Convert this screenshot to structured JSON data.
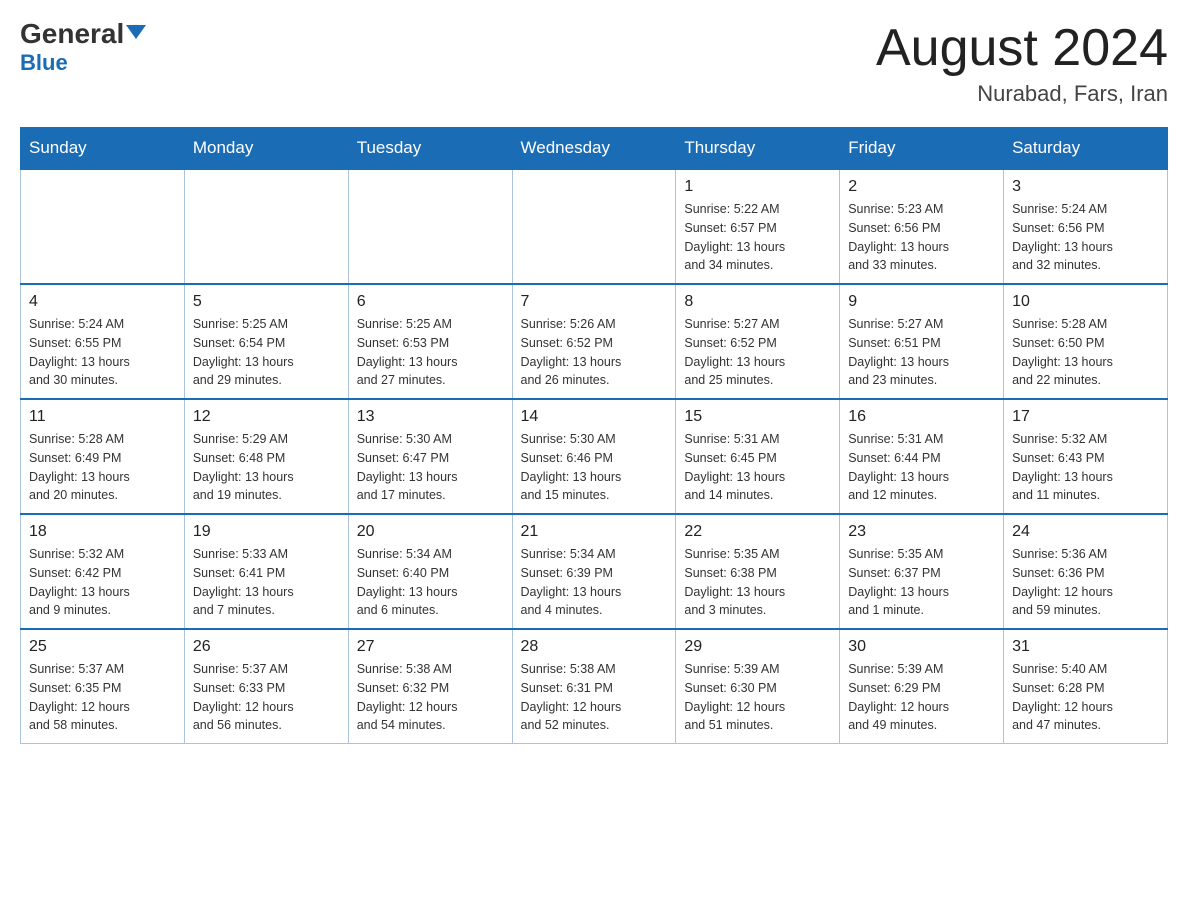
{
  "header": {
    "logo_general": "General",
    "logo_blue": "Blue",
    "title": "August 2024",
    "subtitle": "Nurabad, Fars, Iran"
  },
  "weekdays": [
    "Sunday",
    "Monday",
    "Tuesday",
    "Wednesday",
    "Thursday",
    "Friday",
    "Saturday"
  ],
  "weeks": [
    [
      {
        "day": "",
        "info": ""
      },
      {
        "day": "",
        "info": ""
      },
      {
        "day": "",
        "info": ""
      },
      {
        "day": "",
        "info": ""
      },
      {
        "day": "1",
        "info": "Sunrise: 5:22 AM\nSunset: 6:57 PM\nDaylight: 13 hours\nand 34 minutes."
      },
      {
        "day": "2",
        "info": "Sunrise: 5:23 AM\nSunset: 6:56 PM\nDaylight: 13 hours\nand 33 minutes."
      },
      {
        "day": "3",
        "info": "Sunrise: 5:24 AM\nSunset: 6:56 PM\nDaylight: 13 hours\nand 32 minutes."
      }
    ],
    [
      {
        "day": "4",
        "info": "Sunrise: 5:24 AM\nSunset: 6:55 PM\nDaylight: 13 hours\nand 30 minutes."
      },
      {
        "day": "5",
        "info": "Sunrise: 5:25 AM\nSunset: 6:54 PM\nDaylight: 13 hours\nand 29 minutes."
      },
      {
        "day": "6",
        "info": "Sunrise: 5:25 AM\nSunset: 6:53 PM\nDaylight: 13 hours\nand 27 minutes."
      },
      {
        "day": "7",
        "info": "Sunrise: 5:26 AM\nSunset: 6:52 PM\nDaylight: 13 hours\nand 26 minutes."
      },
      {
        "day": "8",
        "info": "Sunrise: 5:27 AM\nSunset: 6:52 PM\nDaylight: 13 hours\nand 25 minutes."
      },
      {
        "day": "9",
        "info": "Sunrise: 5:27 AM\nSunset: 6:51 PM\nDaylight: 13 hours\nand 23 minutes."
      },
      {
        "day": "10",
        "info": "Sunrise: 5:28 AM\nSunset: 6:50 PM\nDaylight: 13 hours\nand 22 minutes."
      }
    ],
    [
      {
        "day": "11",
        "info": "Sunrise: 5:28 AM\nSunset: 6:49 PM\nDaylight: 13 hours\nand 20 minutes."
      },
      {
        "day": "12",
        "info": "Sunrise: 5:29 AM\nSunset: 6:48 PM\nDaylight: 13 hours\nand 19 minutes."
      },
      {
        "day": "13",
        "info": "Sunrise: 5:30 AM\nSunset: 6:47 PM\nDaylight: 13 hours\nand 17 minutes."
      },
      {
        "day": "14",
        "info": "Sunrise: 5:30 AM\nSunset: 6:46 PM\nDaylight: 13 hours\nand 15 minutes."
      },
      {
        "day": "15",
        "info": "Sunrise: 5:31 AM\nSunset: 6:45 PM\nDaylight: 13 hours\nand 14 minutes."
      },
      {
        "day": "16",
        "info": "Sunrise: 5:31 AM\nSunset: 6:44 PM\nDaylight: 13 hours\nand 12 minutes."
      },
      {
        "day": "17",
        "info": "Sunrise: 5:32 AM\nSunset: 6:43 PM\nDaylight: 13 hours\nand 11 minutes."
      }
    ],
    [
      {
        "day": "18",
        "info": "Sunrise: 5:32 AM\nSunset: 6:42 PM\nDaylight: 13 hours\nand 9 minutes."
      },
      {
        "day": "19",
        "info": "Sunrise: 5:33 AM\nSunset: 6:41 PM\nDaylight: 13 hours\nand 7 minutes."
      },
      {
        "day": "20",
        "info": "Sunrise: 5:34 AM\nSunset: 6:40 PM\nDaylight: 13 hours\nand 6 minutes."
      },
      {
        "day": "21",
        "info": "Sunrise: 5:34 AM\nSunset: 6:39 PM\nDaylight: 13 hours\nand 4 minutes."
      },
      {
        "day": "22",
        "info": "Sunrise: 5:35 AM\nSunset: 6:38 PM\nDaylight: 13 hours\nand 3 minutes."
      },
      {
        "day": "23",
        "info": "Sunrise: 5:35 AM\nSunset: 6:37 PM\nDaylight: 13 hours\nand 1 minute."
      },
      {
        "day": "24",
        "info": "Sunrise: 5:36 AM\nSunset: 6:36 PM\nDaylight: 12 hours\nand 59 minutes."
      }
    ],
    [
      {
        "day": "25",
        "info": "Sunrise: 5:37 AM\nSunset: 6:35 PM\nDaylight: 12 hours\nand 58 minutes."
      },
      {
        "day": "26",
        "info": "Sunrise: 5:37 AM\nSunset: 6:33 PM\nDaylight: 12 hours\nand 56 minutes."
      },
      {
        "day": "27",
        "info": "Sunrise: 5:38 AM\nSunset: 6:32 PM\nDaylight: 12 hours\nand 54 minutes."
      },
      {
        "day": "28",
        "info": "Sunrise: 5:38 AM\nSunset: 6:31 PM\nDaylight: 12 hours\nand 52 minutes."
      },
      {
        "day": "29",
        "info": "Sunrise: 5:39 AM\nSunset: 6:30 PM\nDaylight: 12 hours\nand 51 minutes."
      },
      {
        "day": "30",
        "info": "Sunrise: 5:39 AM\nSunset: 6:29 PM\nDaylight: 12 hours\nand 49 minutes."
      },
      {
        "day": "31",
        "info": "Sunrise: 5:40 AM\nSunset: 6:28 PM\nDaylight: 12 hours\nand 47 minutes."
      }
    ]
  ]
}
